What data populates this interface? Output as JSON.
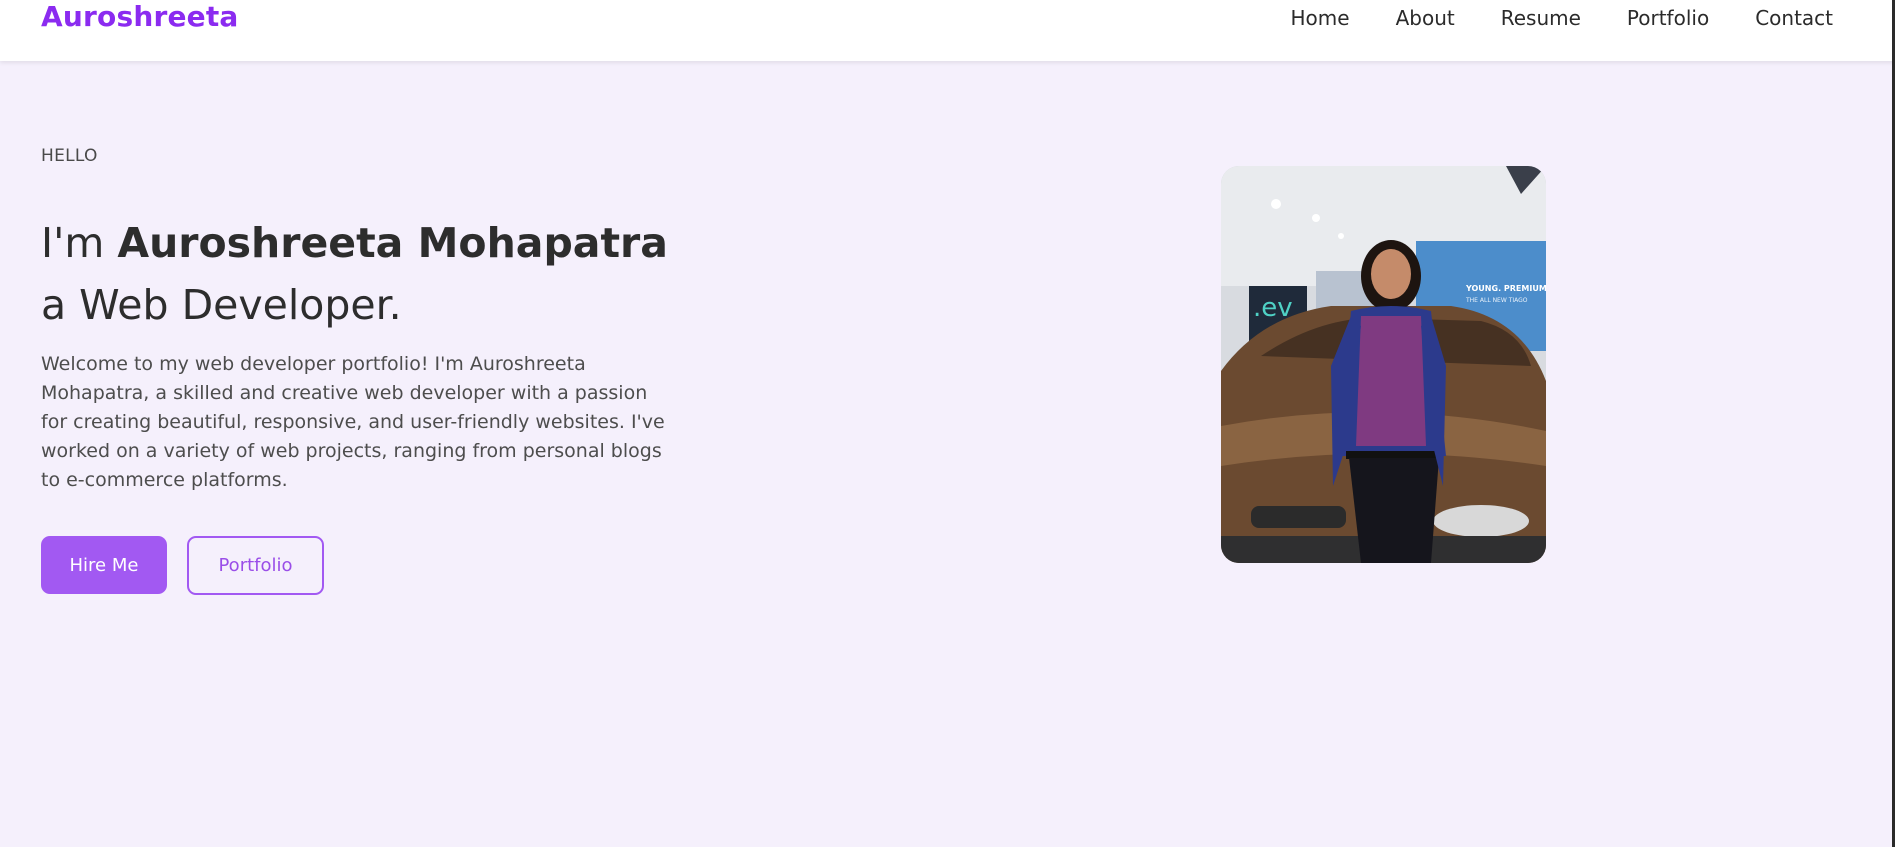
{
  "brand": "Auroshreeta",
  "nav": {
    "home": "Home",
    "about": "About",
    "resume": "Resume",
    "portfolio": "Portfolio",
    "contact": "Contact"
  },
  "hero": {
    "greeting": "HELLO",
    "headline_prefix": "I'm ",
    "headline_name": "Auroshreeta Mohapatra",
    "headline_role": "a Web Developer.",
    "intro": "Welcome to my web developer portfolio! I'm Auroshreeta Mohapatra, a skilled and creative web developer with a passion for creating beautiful, responsive, and user-friendly websites. I've worked on a variety of web projects, ranging from personal blogs to e-commerce platforms.",
    "hire_label": "Hire Me",
    "portfolio_label": "Portfolio"
  },
  "photo": {
    "sign_text": ".ev",
    "banner_text": "YOUNG. PREMIUM. E",
    "banner_subtext": "THE ALL NEW TIAGO"
  },
  "colors": {
    "brand": "#8b2bf0",
    "accent": "#a259f2",
    "background": "#f5f0fc"
  }
}
